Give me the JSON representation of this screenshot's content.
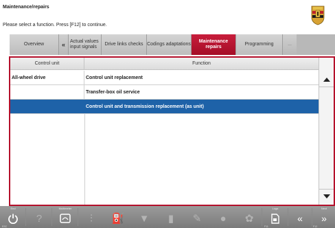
{
  "header": {
    "title": "Maintenance/repairs",
    "subtitle": "Please select a function. Press [F12] to continue."
  },
  "tabs": {
    "overview": "Overview",
    "arrow": "«",
    "actual_values": "Actual values input signals",
    "drive_links": "Drive links checks",
    "codings": "Codings adaptations",
    "maintenance": "Maintenance repairs",
    "programming": "Programming",
    "more": "..."
  },
  "table": {
    "columns": [
      "Control unit",
      "Function"
    ],
    "rows": [
      {
        "unit": "All-wheel drive",
        "function": "Control unit replacement",
        "selected": false
      },
      {
        "unit": "",
        "function": "Transfer-box oil service",
        "selected": false
      },
      {
        "unit": "",
        "function": "Control unit and transmission replacement (as unit)",
        "selected": true
      }
    ]
  },
  "toolbar": {
    "end_label": "End",
    "end_key": "ESC",
    "multimeter_label": "Multimeter",
    "logs_label": "Logs",
    "logs_key": "F11",
    "next_label": "Next",
    "next_key": "F12"
  },
  "colors": {
    "accent_red": "#b40f2a",
    "selection_blue": "#1e62a8",
    "toolbar_gray": "#8a8a8a"
  },
  "icons": [
    "porsche-crest-icon",
    "power-icon",
    "help-icon",
    "multimeter-icon",
    "chart-icon",
    "fuel-icon",
    "filter-icon",
    "bulb-icon",
    "wrench-icon",
    "record-icon",
    "settings-icon",
    "logs-icon",
    "back-icon",
    "next-icon"
  ]
}
